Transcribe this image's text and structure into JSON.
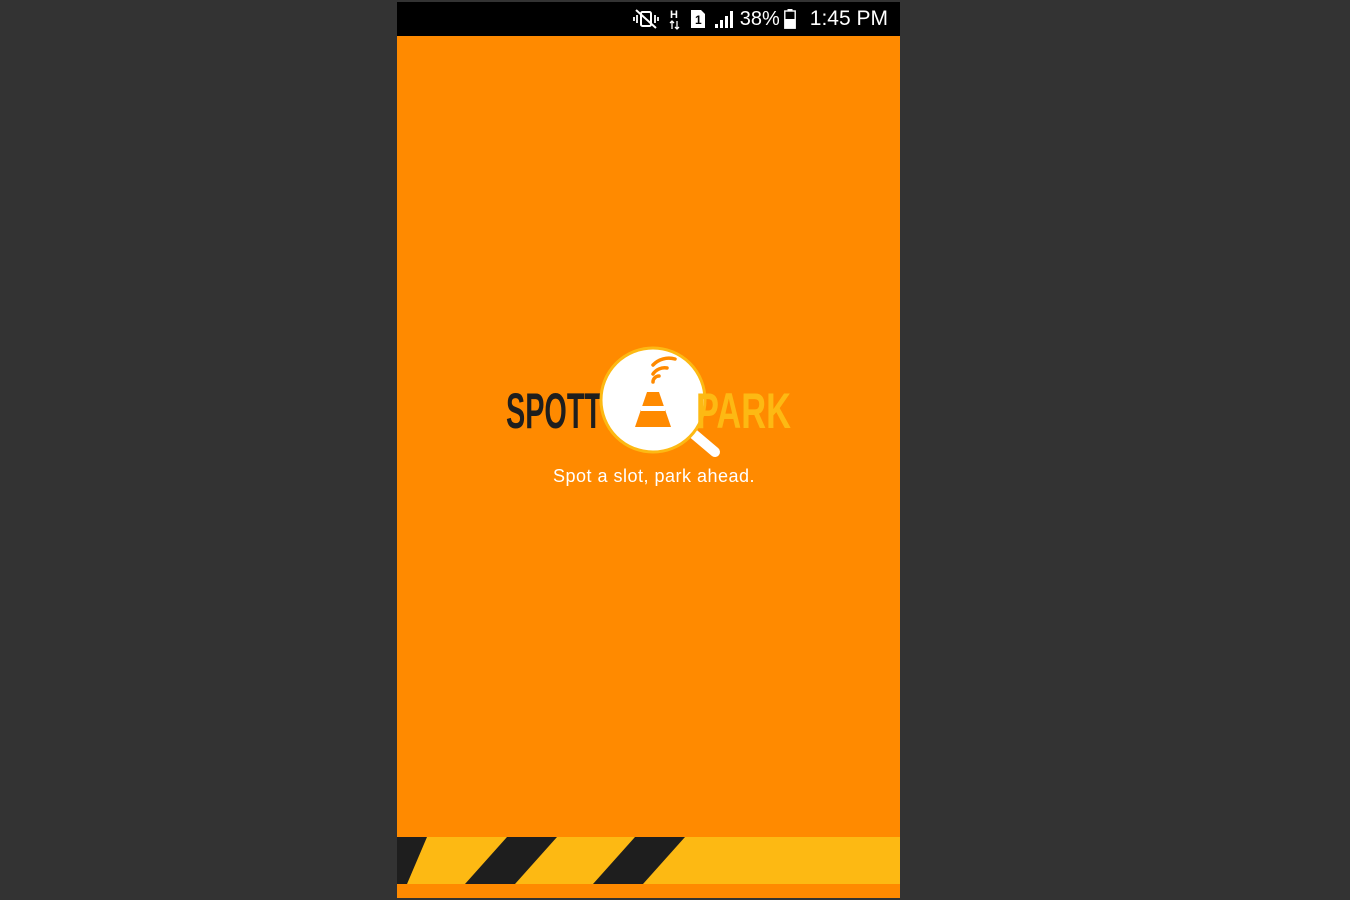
{
  "status_bar": {
    "icons": [
      "vibrate-mute-icon",
      "hplus-data-icon",
      "sim-1-icon",
      "signal-icon",
      "battery-icon"
    ],
    "network_type": "H",
    "sim_slot": "1",
    "battery_percent": "38%",
    "time": "1:45 PM"
  },
  "splash": {
    "logo_text_dark": "SPOTT",
    "logo_text_light": "PARK",
    "tagline": "Spot a slot, park ahead."
  },
  "colors": {
    "background": "#FF8A00",
    "status_bar": "#000000",
    "logo_dark": "#1E1E1E",
    "logo_accent": "#FDB913",
    "stripe_dark": "#1E1E1E",
    "stripe_light": "#FDB913",
    "outer_frame": "#333333"
  }
}
